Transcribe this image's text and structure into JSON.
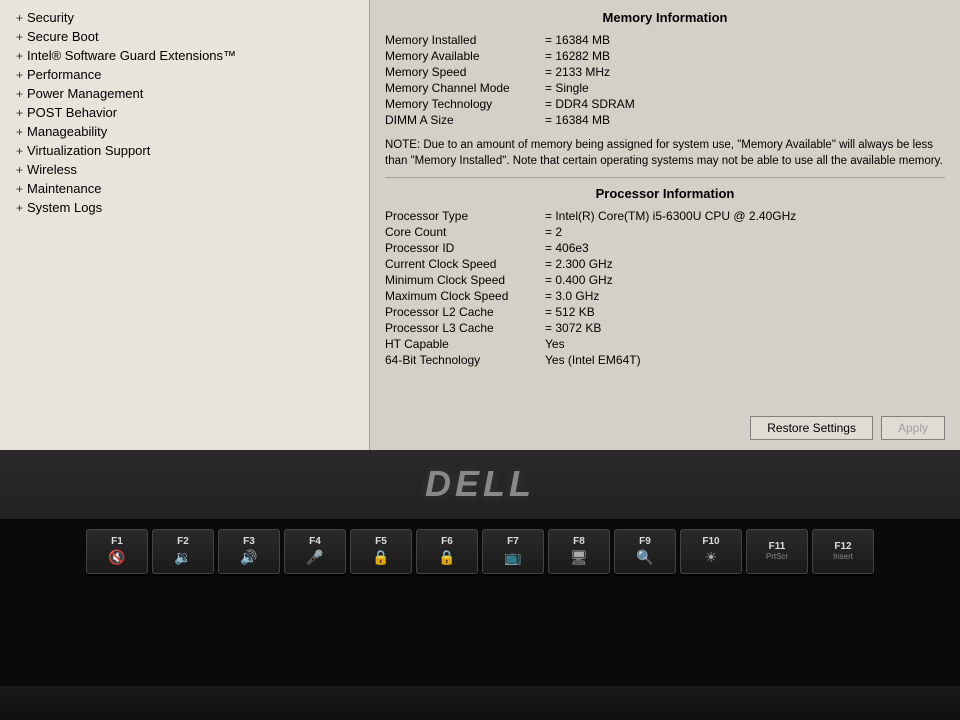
{
  "bios": {
    "title": "Memory Information",
    "memory_section": {
      "title": "Memory Information",
      "fields": [
        {
          "label": "Memory Installed",
          "value": "= 16384 MB"
        },
        {
          "label": "Memory Available",
          "value": "= 16282 MB"
        },
        {
          "label": "Memory Speed",
          "value": "= 2133 MHz"
        },
        {
          "label": "Memory Channel Mode",
          "value": "= Single"
        },
        {
          "label": "Memory Technology",
          "value": "= DDR4 SDRAM"
        },
        {
          "label": "DIMM A Size",
          "value": "= 16384 MB"
        }
      ],
      "note": "NOTE: Due to an amount of memory being assigned for system use, \"Memory Available\" will always be less than \"Memory Installed\". Note that certain operating systems may not be able to use all the available memory."
    },
    "processor_section": {
      "title": "Processor Information",
      "fields": [
        {
          "label": "Processor Type",
          "value": "= Intel(R) Core(TM) i5-6300U CPU @ 2.40GHz"
        },
        {
          "label": "Core Count",
          "value": "= 2"
        },
        {
          "label": "Processor ID",
          "value": "= 406e3"
        },
        {
          "label": "Current Clock Speed",
          "value": "= 2.300 GHz"
        },
        {
          "label": "Minimum Clock Speed",
          "value": "= 0.400 GHz"
        },
        {
          "label": "Maximum Clock Speed",
          "value": "= 3.0 GHz"
        },
        {
          "label": "Processor L2 Cache",
          "value": "= 512 KB"
        },
        {
          "label": "Processor L3 Cache",
          "value": "= 3072 KB"
        },
        {
          "label": "HT Capable",
          "value": "Yes"
        },
        {
          "label": "64-Bit Technology",
          "value": "Yes (Intel EM64T)"
        }
      ]
    },
    "buttons": {
      "restore": "Restore Settings",
      "apply": "Apply"
    }
  },
  "sidebar": {
    "items": [
      {
        "label": "Security"
      },
      {
        "label": "Secure Boot"
      },
      {
        "label": "Intel® Software Guard Extensions™"
      },
      {
        "label": "Performance"
      },
      {
        "label": "Power Management"
      },
      {
        "label": "POST Behavior"
      },
      {
        "label": "Manageability"
      },
      {
        "label": "Virtualization Support"
      },
      {
        "label": "Wireless"
      },
      {
        "label": "Maintenance"
      },
      {
        "label": "System Logs"
      }
    ]
  },
  "keyboard": {
    "function_keys": [
      {
        "label": "F1",
        "icon": "🔇"
      },
      {
        "label": "F2",
        "icon": "🔉"
      },
      {
        "label": "F3",
        "icon": "🔊"
      },
      {
        "label": "F4",
        "icon": "🎤"
      },
      {
        "label": "F5",
        "icon": "🔒"
      },
      {
        "label": "F6",
        "icon": "🔒"
      },
      {
        "label": "F7",
        "icon": "📺"
      },
      {
        "label": "F8",
        "icon": "🖥"
      },
      {
        "label": "F9",
        "icon": "🔍"
      },
      {
        "label": "F10",
        "icon": "☀"
      },
      {
        "label": "F11",
        "sublabel": "PrtScr"
      },
      {
        "label": "F12",
        "sublabel": "Insert"
      }
    ]
  },
  "dell": {
    "logo": "DELL"
  }
}
